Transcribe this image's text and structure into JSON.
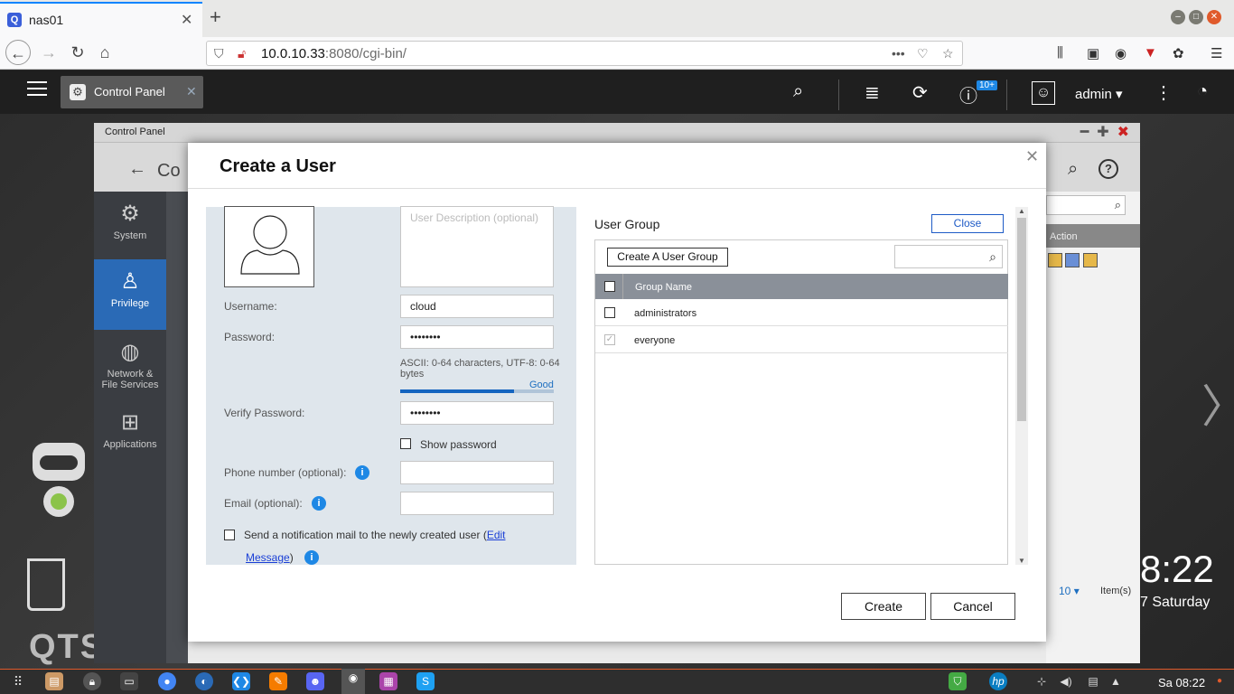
{
  "browser": {
    "tab_title": "nas01",
    "url_host": "10.0.10.33",
    "url_rest": ":8080/cgi-bin/",
    "new_tab_icon": "plus-icon"
  },
  "qts_bar": {
    "app_tab_label": "Control Panel",
    "notification_badge": "10+",
    "user_label": "admin"
  },
  "desktop": {
    "clock": "8:22",
    "day": "7 Saturday",
    "logo": "QTS"
  },
  "control_panel": {
    "window_title": "Control Panel",
    "header_title": "Co",
    "nav": [
      {
        "label": "System",
        "icon": "gear-icon"
      },
      {
        "label": "Privilege",
        "icon": "user-icon"
      },
      {
        "label": "Network & File Services",
        "icon": "globe-icon"
      },
      {
        "label": "Applications",
        "icon": "grid-icon"
      }
    ],
    "action_header": "Action",
    "pager_size": "10",
    "pager_unit": "Item(s)"
  },
  "modal": {
    "title": "Create a User",
    "description_placeholder": "User Description (optional)",
    "username_label": "Username:",
    "username_value": "cloud",
    "password_label": "Password:",
    "password_value": "••••••••",
    "password_hint": "ASCII: 0-64 characters, UTF-8: 0-64 bytes",
    "strength_label": "Good",
    "strength_level": 0.74,
    "verify_label": "Verify Password:",
    "verify_value": "••••••••",
    "show_password_label": "Show password",
    "phone_label": "Phone number (optional):",
    "email_label": "Email (optional):",
    "notify_label": "Send a notification mail to the newly created user (",
    "notify_link1": "Edit",
    "notify_link2": "Message",
    "notify_close": ")",
    "user_group": {
      "title": "User Group",
      "close_label": "Close",
      "create_group_label": "Create A User Group",
      "column_header": "Group Name",
      "rows": [
        {
          "name": "administrators",
          "checked": false
        },
        {
          "name": "everyone",
          "checked": true
        }
      ]
    },
    "create_label": "Create",
    "cancel_label": "Cancel"
  },
  "taskbar": {
    "time": "Sa 08:22"
  }
}
